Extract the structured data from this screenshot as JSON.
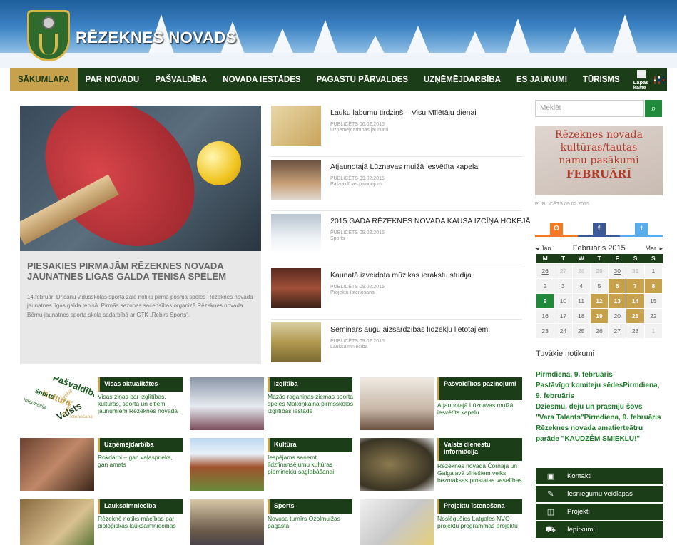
{
  "site": {
    "title": "RĒZEKNES NOVADS"
  },
  "nav": {
    "items": [
      "SĀKUMLAPA",
      "PAR NOVADU",
      "PAŠVALDĪBA",
      "NOVADA IESTĀDES",
      "PAGASTU PĀRVALDES",
      "UZŅĒMĒJDARBĪBA",
      "ES JAUNUMI",
      "TŪRISMS"
    ],
    "map_label": "Lapas karte"
  },
  "feature": {
    "title": "PIESAKIES PIRMAJĀM RĒZEKNES NOVADA JAUNATNES LĪGAS GALDA TENISA SPĒLĒM",
    "text": "14.februārī Dricānu vidusskolas sporta zālē notiks pirmā posma spēles Rēzeknes novada jaunatnes līgas galda tenisā. Pirmās sezonas sacensības organizē Rēzeknes novada Bērnu-jaunatnes sporta skola sadarbībā ar GTK „Rebirs Sports\"."
  },
  "news": [
    {
      "title": "Lauku labumu tirdziņš – Visu Mīlētāju dienai",
      "date": "PUBLICĒTS 06.02.2015",
      "category": "Uzņēmējdarbības jaunumi"
    },
    {
      "title": "Atjaunotajā Lūznavas muižā iesvētīta kapela",
      "date": "PUBLICĒTS 09.02.2015",
      "category": "Pašvaldības paziņojumi"
    },
    {
      "title": "2015.GADA RĒZEKNES NOVADA KAUSA IZCĪŅA HOKEJĀ",
      "date": "PUBLICĒTS 09.02.2015",
      "category": "Sports"
    },
    {
      "title": "Kaunatā izveidota mūzikas ierakstu studija",
      "date": "PUBLICĒTS 09.02.2015",
      "category": "Projektu īstenošana"
    },
    {
      "title": "Seminārs augu aizsardzības līdzekļu lietotājiem",
      "date": "PUBLICĒTS 09.02.2015",
      "category": "Lauksaimniecība"
    }
  ],
  "categories": [
    {
      "label": "Visas aktualitātes",
      "text": "Visas ziņas par izglītības, kultūras, sporta un citiem jaunumiem Rēzeknes novadā"
    },
    {
      "label": "Izglītība",
      "text": "Mazās raganiņas ziemas sporta spēles Mākoņkalna pirmsskolas izglītības iestādē"
    },
    {
      "label": "Pašvaldības paziņojumi",
      "text": "Atjaunotajā Lūznavas muižā iesvētīts kapelu"
    },
    {
      "label": "Uzņēmējdarbība",
      "text": "Rokdarbi – gan vaļasprieks, gan amats"
    },
    {
      "label": "Kultūra",
      "text": "Iespējams saņemt līdzfinansējumu kultūras pieminekļu saglabāšanai"
    },
    {
      "label": "Valsts dienestu informācija",
      "text": "Rēzeknes novada Čornajā un Gaigalavā vīriešiem veiks bezmaksas prostatas veselības"
    },
    {
      "label": "Lauksaimniecība",
      "text": "Rēzeknē notiks mācības par bioloģiskās lauksaimniecības"
    },
    {
      "label": "Sports",
      "text": "Novusa turnīrs Ozolmuižas pagastā"
    },
    {
      "label": "Projektu īstenošana",
      "text": "Noslēgušies Latgales NVO projektu programmas projektu"
    }
  ],
  "word_cloud": [
    "Pašvaldības",
    "Kultūra",
    "Sports",
    "Informācija",
    "Valsts",
    "Izglītība",
    "Projekti",
    "īstenošana"
  ],
  "sidebar": {
    "search_placeholder": "Meklēt",
    "poster_lines": [
      "Rēzeknes novada",
      "kultūras/tautas",
      "namu pasākumi",
      "FEBRUĀRĪ"
    ],
    "poster_date": "PUBLICĒTS 05.02.2015",
    "social": [
      "draugiem",
      "f",
      "twitter"
    ],
    "calendar": {
      "prev": "◂ Jan.",
      "month": "Februāris 2015",
      "next": "Mar. ▸",
      "weekdays": [
        "M",
        "T",
        "W",
        "T",
        "F",
        "S",
        "S"
      ],
      "weeks": [
        [
          "26",
          "27",
          "28",
          "29",
          "30",
          "31",
          "1"
        ],
        [
          "2",
          "3",
          "4",
          "5",
          "6",
          "7",
          "8"
        ],
        [
          "9",
          "10",
          "11",
          "12",
          "13",
          "14",
          "15"
        ],
        [
          "16",
          "17",
          "18",
          "19",
          "20",
          "21",
          "22"
        ],
        [
          "23",
          "24",
          "25",
          "26",
          "27",
          "28",
          "1"
        ]
      ]
    },
    "events_heading": "Tuvākie notikumi",
    "events": [
      "Pirmdiena, 9. februāris",
      "Pastāvīgo komiteju sēdesPirmdiena, 9. februāris",
      "Dziesmu, deju un prasmju šovs \"Vara Talants\"Pirmdiena, 9. februāris",
      "Rēzeknes novada amatierteātru parāde \"KAUDZĒM SMIEKLU!\""
    ],
    "links": [
      {
        "label": "Kontakti",
        "icon": "contacts-icon"
      },
      {
        "label": "Iesniegumu veidlapas",
        "icon": "edit-icon"
      },
      {
        "label": "Projekti",
        "icon": "projects-icon"
      },
      {
        "label": "Iepirkumi",
        "icon": "cart-icon"
      }
    ]
  },
  "colors": {
    "accent_green": "#1b3d17",
    "gold": "#c7a14c",
    "link_green": "#1e7a2b"
  }
}
